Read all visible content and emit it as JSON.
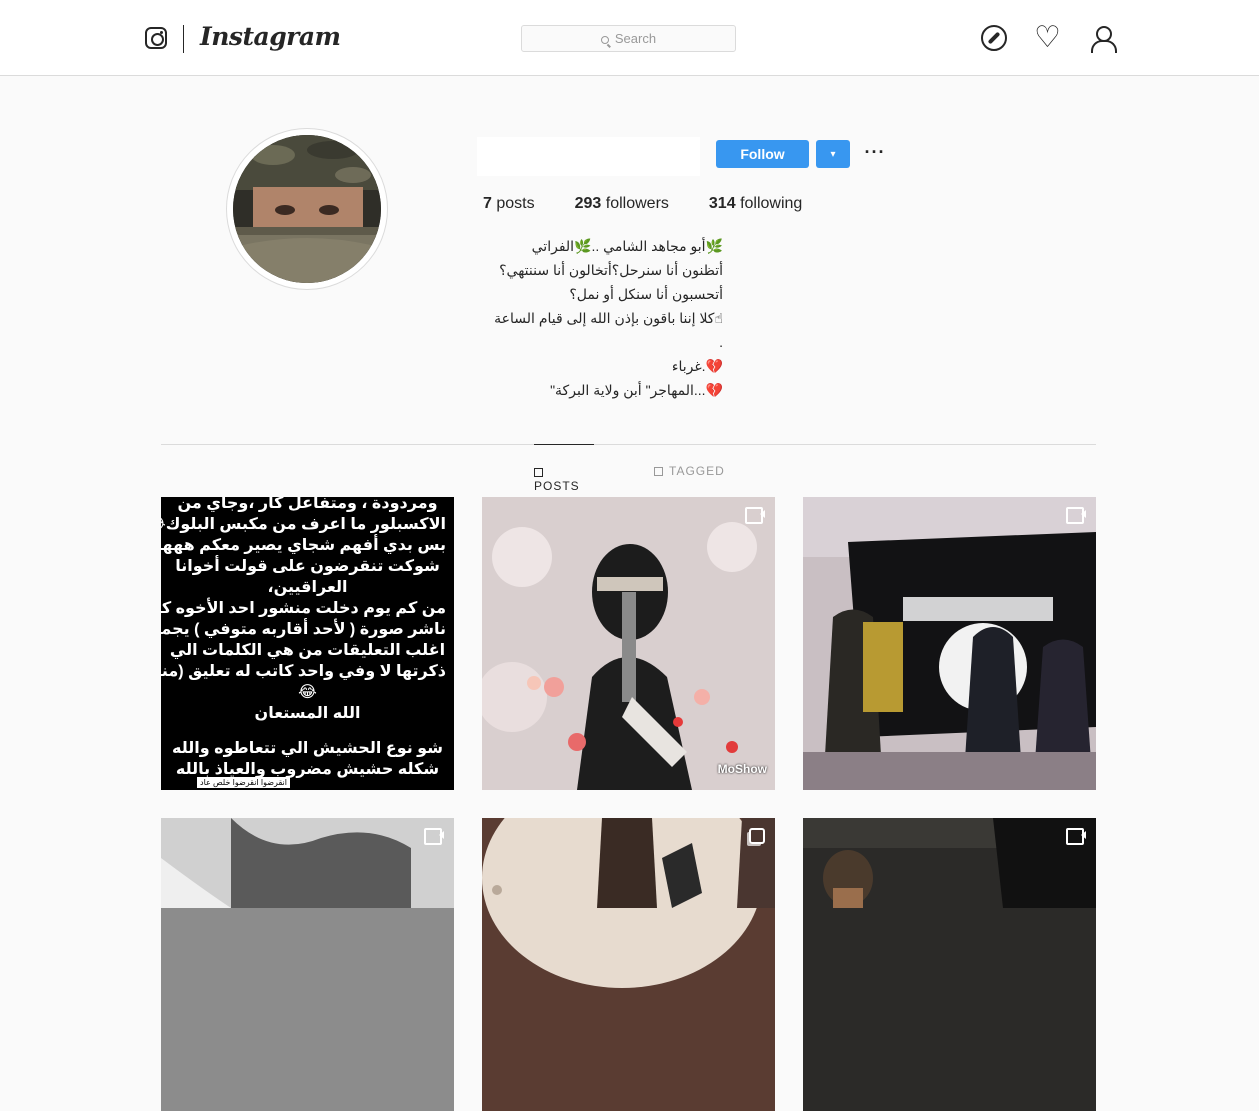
{
  "header": {
    "wordmark": "Instagram",
    "search_placeholder": "Search",
    "icons": [
      "instagram-logo-icon",
      "explore-compass-icon",
      "heart-icon",
      "profile-person-icon"
    ]
  },
  "profile": {
    "follow_label": "Follow",
    "dropdown_label": "▾",
    "more_label": "···",
    "stats": {
      "posts_count": "7",
      "posts_label": "posts",
      "followers_count": "293",
      "followers_label": "followers",
      "following_count": "314",
      "following_label": "following"
    },
    "bio": [
      "🌿أبو مجاهد الشامي ..🌿الفراتي",
      "أتظنون أنا سنرحل؟أتخالون أنا سننتهي؟",
      "أتحسبون أنا سنكل أو نمل؟",
      "☝كلا إننا باقون بإذن الله إلى قيام الساعة",
      ".",
      "💔.غرباء",
      "💔...المهاجر\" أبن ولاية البركة\""
    ]
  },
  "tabs": {
    "posts": "Posts",
    "tagged": "Tagged"
  },
  "grid": {
    "post1_lines": [
      "ومردودة ، ومتفاعل كار ،وجاي من",
      "الاكسبلور ما اعرف من مكبس البلوك😂",
      "بس بدي أفهم شجاي يصير معكم ههههه",
      "شوكت تنقرضون على قولت أخوانا",
      "العراقيين،",
      "من كم يوم دخلت منشور احد الأخوه كان",
      "ناشر صورة ( لأحد أقاربه متوفي ) يجماعه",
      "اغلب التعليقات من هي الكلمات الي",
      "ذكرتها لا وفي واحد كاتب له تعليق (منور)",
      "😂",
      "الله المستعان",
      "",
      "شو نوع الحشيش الي تتعاطوه والله",
      "شكله حشيش مضروب والعياذ بالله"
    ],
    "post1_footer": "انقرضوا انقرضوا خلص عاد",
    "post2_watermark": "MoShow"
  }
}
